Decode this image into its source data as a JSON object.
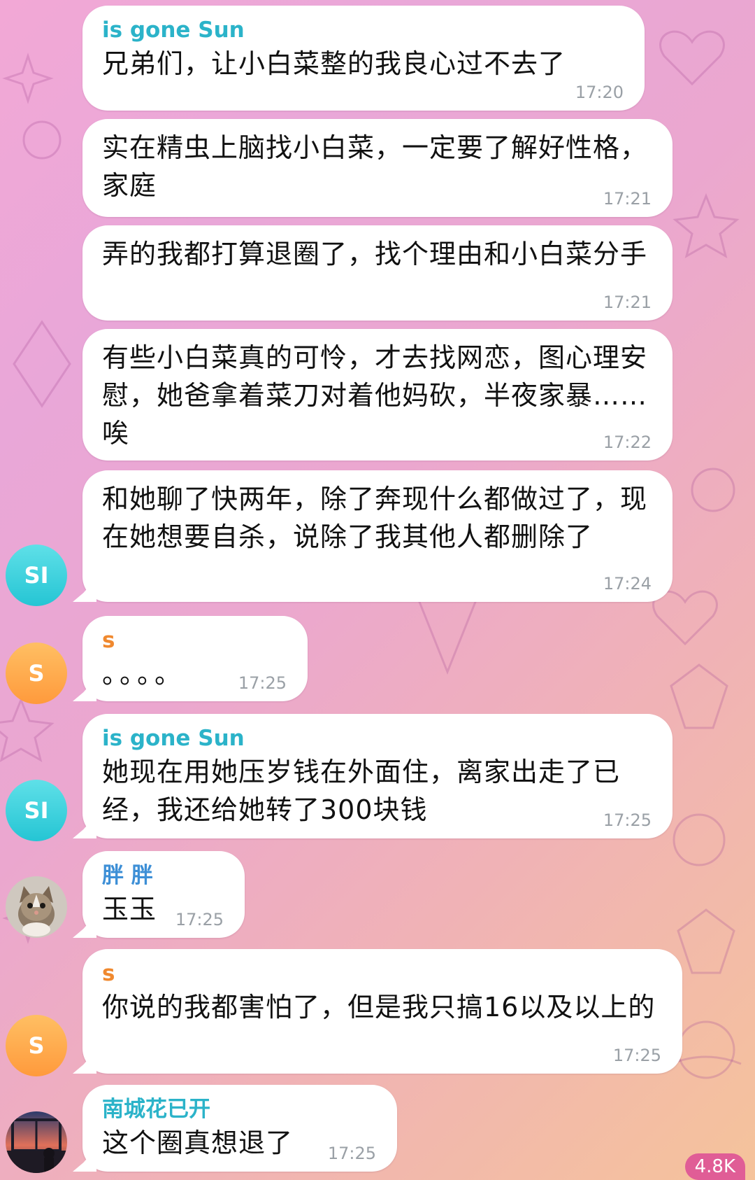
{
  "messages": [
    {
      "sender": "is gone Sun",
      "text": "兄弟们，让小白菜整的我良心过不去了",
      "time": "17:20"
    },
    {
      "text": "实在精虫上脑找小白菜，一定要了解好性格，家庭",
      "time": "17:21"
    },
    {
      "text": "弄的我都打算退圈了，找个理由和小白菜分手",
      "time": "17:21"
    },
    {
      "text": "有些小白菜真的可怜，才去找网恋，图心理安慰，她爸拿着菜刀对着他妈砍，半夜家暴……唉",
      "time": "17:22"
    },
    {
      "text": "和她聊了快两年，除了奔现什么都做过了，现在她想要自杀，说除了我其他人都删除了",
      "time": "17:24"
    },
    {
      "sender": "s",
      "text": "。。。。",
      "time": "17:25"
    },
    {
      "sender": "is gone Sun",
      "text": "她现在用她压岁钱在外面住，离家出走了已经，我还给她转了300块钱",
      "time": "17:25"
    },
    {
      "sender": "胖 胖",
      "text": "玉玉",
      "time": "17:25"
    },
    {
      "sender": "s",
      "text": "你说的我都害怕了，但是我只搞16以及以上的",
      "time": "17:25"
    },
    {
      "sender": "南城花已开",
      "text": "这个圈真想退了",
      "time": "17:25"
    }
  ],
  "avatars": {
    "sun_initials": "SI",
    "s_initial": "S",
    "pangpang": "cat-photo-avatar",
    "nancheng": "sunset-photo-avatar"
  },
  "colors": {
    "sun_name": "#2bb3c9",
    "s_name": "#f0892f",
    "pangpang_name": "#3d8fd6",
    "nancheng_name": "#2bb3c9",
    "badge": "#e05d96"
  },
  "badge": {
    "count": "4.8K"
  }
}
